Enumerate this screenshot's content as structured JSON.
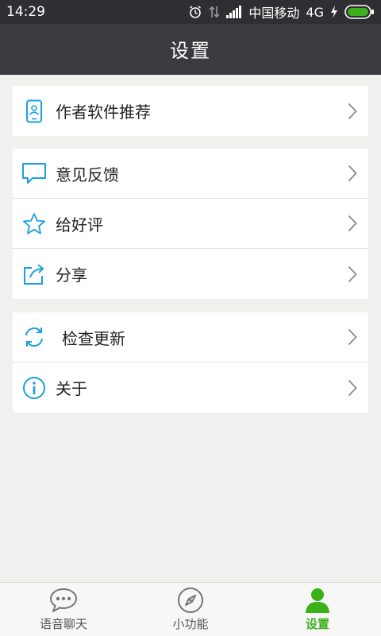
{
  "status_bar": {
    "time": "14:29",
    "carrier": "中国移动",
    "network": "4G",
    "icons": [
      "alarm-icon",
      "data-arrows-icon",
      "signal-icon",
      "charging-icon",
      "battery-icon"
    ]
  },
  "header": {
    "title": "设置"
  },
  "groups": [
    {
      "items": [
        {
          "label": "作者软件推荐",
          "icon": "phone-profile-icon"
        }
      ]
    },
    {
      "items": [
        {
          "label": "意见反馈",
          "icon": "chat-bubble-icon"
        },
        {
          "label": "给好评",
          "icon": "star-icon"
        },
        {
          "label": "分享",
          "icon": "share-icon"
        }
      ]
    },
    {
      "items": [
        {
          "label": "检查更新",
          "icon": "refresh-icon"
        },
        {
          "label": "关于",
          "icon": "info-icon"
        }
      ]
    }
  ],
  "bottom_nav": {
    "items": [
      {
        "label": "语音聊天",
        "icon": "chat-dots-icon",
        "active": false
      },
      {
        "label": "小功能",
        "icon": "compass-icon",
        "active": false
      },
      {
        "label": "设置",
        "icon": "user-icon",
        "active": true
      }
    ]
  },
  "colors": {
    "accent_blue": "#1aa0e0",
    "active_green": "#3cb019",
    "header_bg": "#3a3a3f",
    "page_bg": "#f0f0ee"
  }
}
